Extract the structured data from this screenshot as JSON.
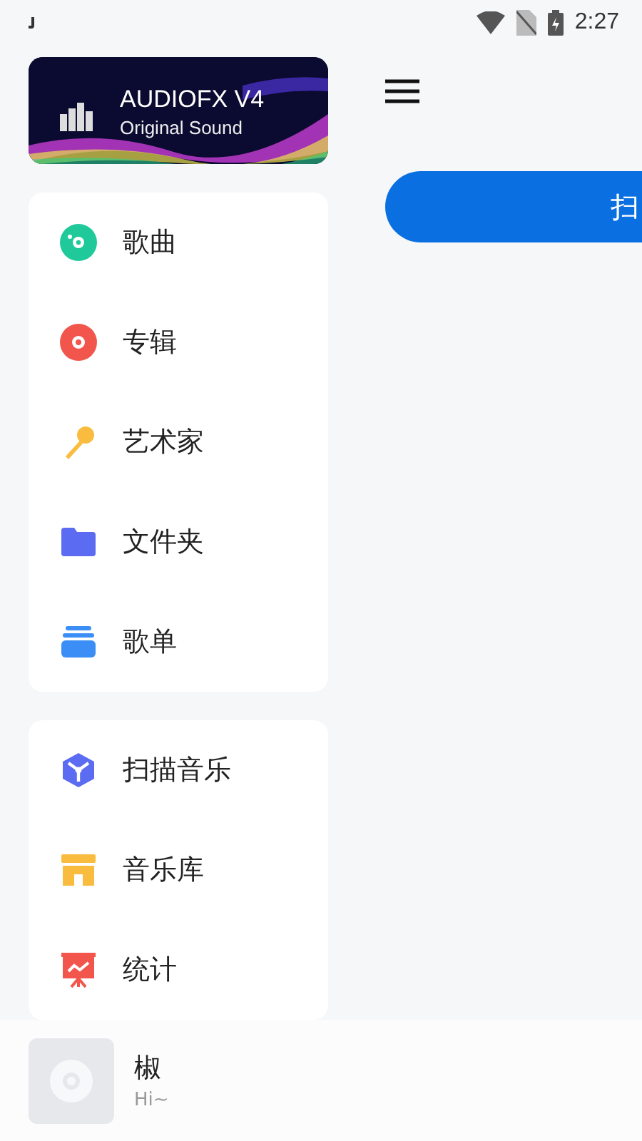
{
  "status_bar": {
    "time": "2:27"
  },
  "banner": {
    "title": "AUDIOFX V4",
    "subtitle": "Original Sound"
  },
  "nav_groups": [
    {
      "items": [
        {
          "label": "歌曲",
          "kind": "disc"
        },
        {
          "label": "专辑",
          "kind": "album"
        },
        {
          "label": "艺术家",
          "kind": "mic"
        },
        {
          "label": "文件夹",
          "kind": "folder"
        },
        {
          "label": "歌单",
          "kind": "stack"
        }
      ]
    },
    {
      "items": [
        {
          "label": "扫描音乐",
          "kind": "scan"
        },
        {
          "label": "音乐库",
          "kind": "store"
        },
        {
          "label": "统计",
          "kind": "chart"
        }
      ]
    }
  ],
  "scan_button": {
    "label": "扫"
  },
  "mini_player": {
    "title": "椒",
    "subtitle": "Hi~"
  }
}
